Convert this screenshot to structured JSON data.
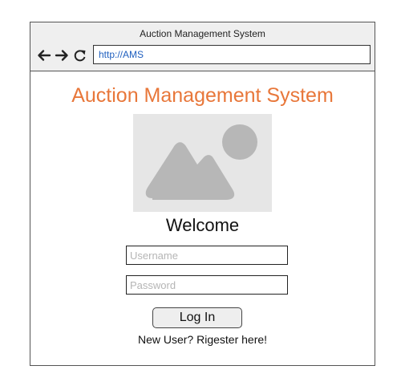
{
  "window": {
    "title": "Auction Management System",
    "url": "http://AMS"
  },
  "toolbar": {
    "icons": [
      "arrow-left-icon",
      "arrow-right-icon",
      "refresh-icon"
    ]
  },
  "page": {
    "heading": "Auction Management System",
    "image_placeholder_icon": "image-placeholder-icon",
    "welcome": "Welcome",
    "username_placeholder": "Username",
    "password_placeholder": "Password",
    "login_label": "Log In",
    "register_text": "New User? Rigester here!"
  },
  "colors": {
    "accent": "#e8773a",
    "chrome_background": "#efefef",
    "image_background": "#e6e6e6",
    "image_shapes": "#b7b7b7",
    "url_text": "#1f5fbf"
  }
}
